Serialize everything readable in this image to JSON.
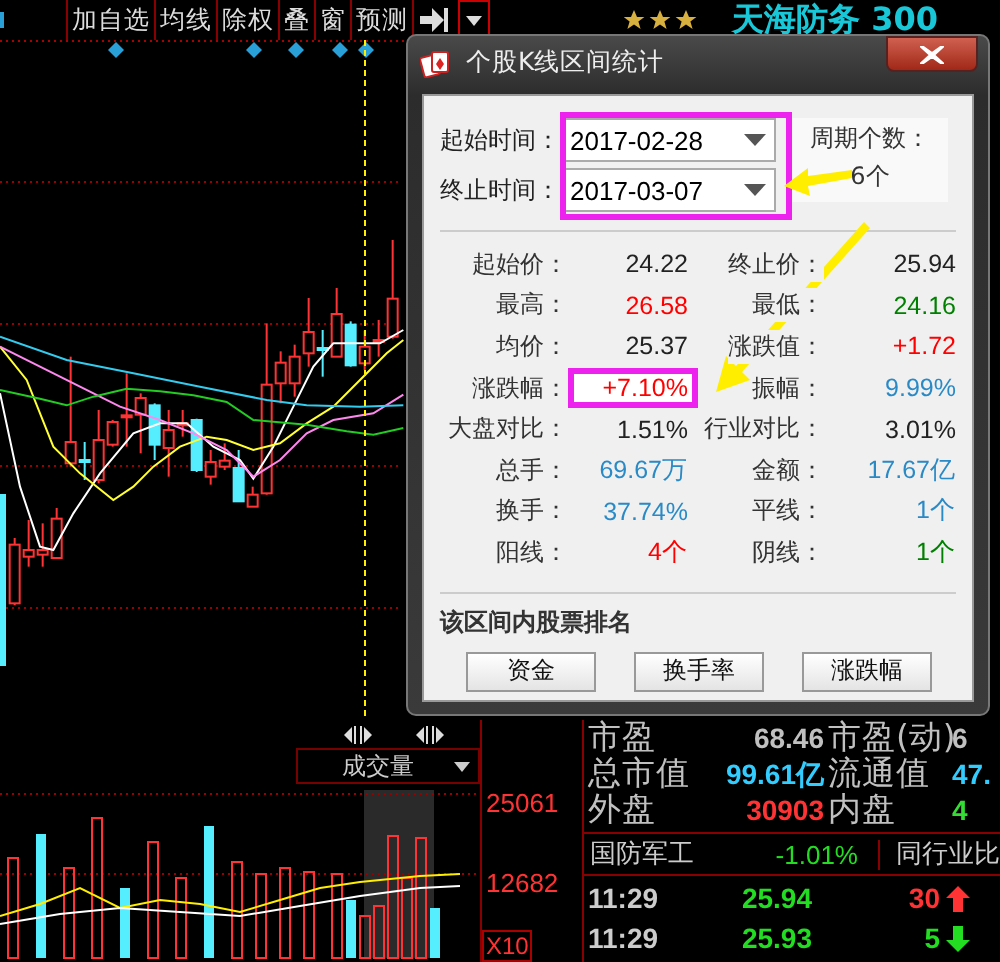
{
  "toolbar": {
    "buttons": [
      "加自选",
      "均线",
      "除权",
      "叠",
      "窗",
      "预测"
    ],
    "stock_title": "天海防务 300"
  },
  "volume_panel": {
    "indicator": "成交量",
    "axis_labels": [
      "25061",
      "12682"
    ],
    "scale": "X10"
  },
  "quote": {
    "rows": [
      [
        {
          "label": "市盈",
          "value": "68.46",
          "color": "#c0c0c0"
        },
        {
          "label": "市盈(动)",
          "value": "6",
          "color": "#c0c0c0"
        }
      ],
      [
        {
          "label": "总市值",
          "value": "99.61亿",
          "color": "#33ccff"
        },
        {
          "label": "流通值",
          "value": "47.",
          "color": "#33ccff"
        }
      ],
      [
        {
          "label": "外盘",
          "value": "30903",
          "color": "#ff3333"
        },
        {
          "label": "内盘",
          "value": "4",
          "color": "#33dd33"
        }
      ]
    ],
    "sector": {
      "name": "国防军工",
      "change": "-1.01%",
      "compare": "同行业比"
    },
    "ticks": [
      {
        "time": "11:29",
        "price": "25.94",
        "volume": "30",
        "up": true
      },
      {
        "time": "11:29",
        "price": "25.93",
        "volume": "5",
        "up": false
      }
    ]
  },
  "dialog": {
    "title": "个股K线区间统计",
    "start_label": "起始时间：",
    "start_date": "2017-02-28",
    "end_label": "终止时间：",
    "end_date": "2017-03-07",
    "dates_highlighted": true,
    "period_label": "周期个数：",
    "period_count": "6个",
    "stats": [
      [
        {
          "label": "起始价：",
          "value": "24.22",
          "color": "#222222",
          "highlighted": false
        },
        {
          "label": "终止价：",
          "value": "25.94",
          "color": "#222222",
          "highlighted": false
        }
      ],
      [
        {
          "label": "最高：",
          "value": "26.58",
          "color": "#ff0000",
          "highlighted": false
        },
        {
          "label": "最低：",
          "value": "24.16",
          "color": "#008000",
          "highlighted": false
        }
      ],
      [
        {
          "label": "均价：",
          "value": "25.37",
          "color": "#222222",
          "highlighted": false
        },
        {
          "label": "涨跌值：",
          "value": "+1.72",
          "color": "#ff0000",
          "highlighted": false
        }
      ],
      [
        {
          "label": "涨跌幅：",
          "value": "+7.10%",
          "color": "#ff0000",
          "highlighted": true
        },
        {
          "label": "振幅：",
          "value": "9.99%",
          "color": "#2a8ac6",
          "highlighted": false
        }
      ],
      [
        {
          "label": "大盘对比：",
          "value": "1.51%",
          "color": "#222222",
          "highlighted": false
        },
        {
          "label": "行业对比：",
          "value": "3.01%",
          "color": "#222222",
          "highlighted": false
        }
      ],
      [
        {
          "label": "总手：",
          "value": "69.67万",
          "color": "#2a8ac6",
          "highlighted": false
        },
        {
          "label": "金额：",
          "value": "17.67亿",
          "color": "#2a8ac6",
          "highlighted": false
        }
      ],
      [
        {
          "label": "换手：",
          "value": "37.74%",
          "color": "#2a8ac6",
          "highlighted": false
        },
        {
          "label": "平线：",
          "value": "1个",
          "color": "#2a8ac6",
          "highlighted": false
        }
      ],
      [
        {
          "label": "阳线：",
          "value": "4个",
          "color": "#ff0000",
          "highlighted": false
        },
        {
          "label": "阴线：",
          "value": "1个",
          "color": "#008000",
          "highlighted": false
        }
      ]
    ],
    "ranking_title": "该区间内股票排名",
    "ranking_buttons": [
      "资金",
      "换手率",
      "涨跌幅"
    ]
  }
}
